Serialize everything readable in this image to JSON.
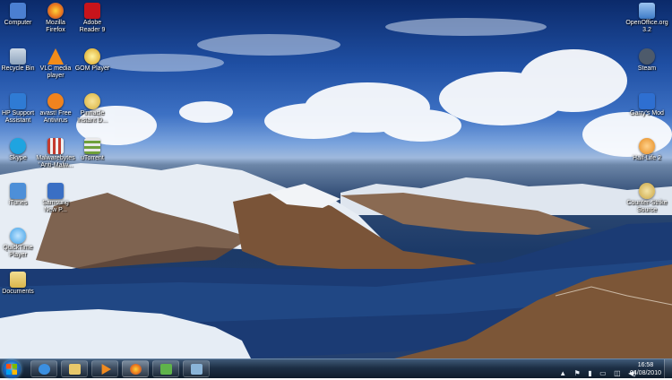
{
  "desktop": {
    "left_icons": [
      {
        "label": "Computer",
        "icon": "computer-icon",
        "color": "#4b7fd1"
      },
      {
        "label": "Mozilla Firefox",
        "icon": "firefox-icon",
        "color": "#e76f1b"
      },
      {
        "label": "Adobe Reader 9",
        "icon": "adobe-reader-icon",
        "color": "#c8141b"
      },
      {
        "label": "Recycle Bin",
        "icon": "recycle-bin-icon",
        "color": "#9fb5cc"
      },
      {
        "label": "VLC media player",
        "icon": "vlc-icon",
        "color": "#f28c1a"
      },
      {
        "label": "GOM Player",
        "icon": "gom-player-icon",
        "color": "#d9a21e"
      },
      {
        "label": "HP Support Assistant",
        "icon": "hp-support-icon",
        "color": "#2f7bd4"
      },
      {
        "label": "avast! Free Antivirus",
        "icon": "avast-icon",
        "color": "#f0831e"
      },
      {
        "label": "Pinnacle Instant D...",
        "icon": "pinnacle-icon",
        "color": "#d9b13a"
      },
      {
        "label": "Skype",
        "icon": "skype-icon",
        "color": "#1fa4e0"
      },
      {
        "label": "Malwarebytes' Anti-Malw...",
        "icon": "malwarebytes-icon",
        "color": "#c43b2f"
      },
      {
        "label": "uTorrent",
        "icon": "utorrent-icon",
        "color": "#6fa03a"
      },
      {
        "label": "iTunes",
        "icon": "itunes-icon",
        "color": "#4d8fd8"
      },
      {
        "label": "Samsung New P...",
        "icon": "samsung-icon",
        "color": "#3a6fc4"
      },
      {
        "label": "QuickTime Player",
        "icon": "quicktime-icon",
        "color": "#3fa0e6"
      },
      {
        "label": "Documents",
        "icon": "folder-icon",
        "color": "#e9c86a"
      }
    ],
    "right_icons": [
      {
        "label": "OpenOffice.org 3.2",
        "icon": "openoffice-icon",
        "color": "#3e7cc8"
      },
      {
        "label": "Steam",
        "icon": "steam-icon",
        "color": "#4d5a6b"
      },
      {
        "label": "Garry's Mod",
        "icon": "garrys-mod-icon",
        "color": "#2e6fd1"
      },
      {
        "label": "Half-Life 2",
        "icon": "half-life-icon",
        "color": "#e58a1e"
      },
      {
        "label": "Counter-Strike Source",
        "icon": "counter-strike-icon",
        "color": "#c9a441"
      }
    ]
  },
  "taskbar": {
    "pinned": [
      {
        "name": "ie",
        "icon": "internet-explorer-icon",
        "color": "#3b8fe0"
      },
      {
        "name": "explorer",
        "icon": "folder-icon",
        "color": "#e9c86a"
      },
      {
        "name": "media",
        "icon": "media-player-icon",
        "color": "#f08a1f"
      },
      {
        "name": "firefox",
        "icon": "firefox-icon",
        "color": "#e76f1b"
      },
      {
        "name": "network",
        "icon": "network-icon",
        "color": "#5fb34a"
      },
      {
        "name": "desktop",
        "icon": "desktop-window-icon",
        "color": "#8ab4d8"
      }
    ],
    "tray_icons": [
      "flag-icon",
      "tool-icon",
      "battery-icon",
      "network-icon",
      "volume-icon"
    ],
    "time": "16:58",
    "date": "04/08/2010"
  }
}
